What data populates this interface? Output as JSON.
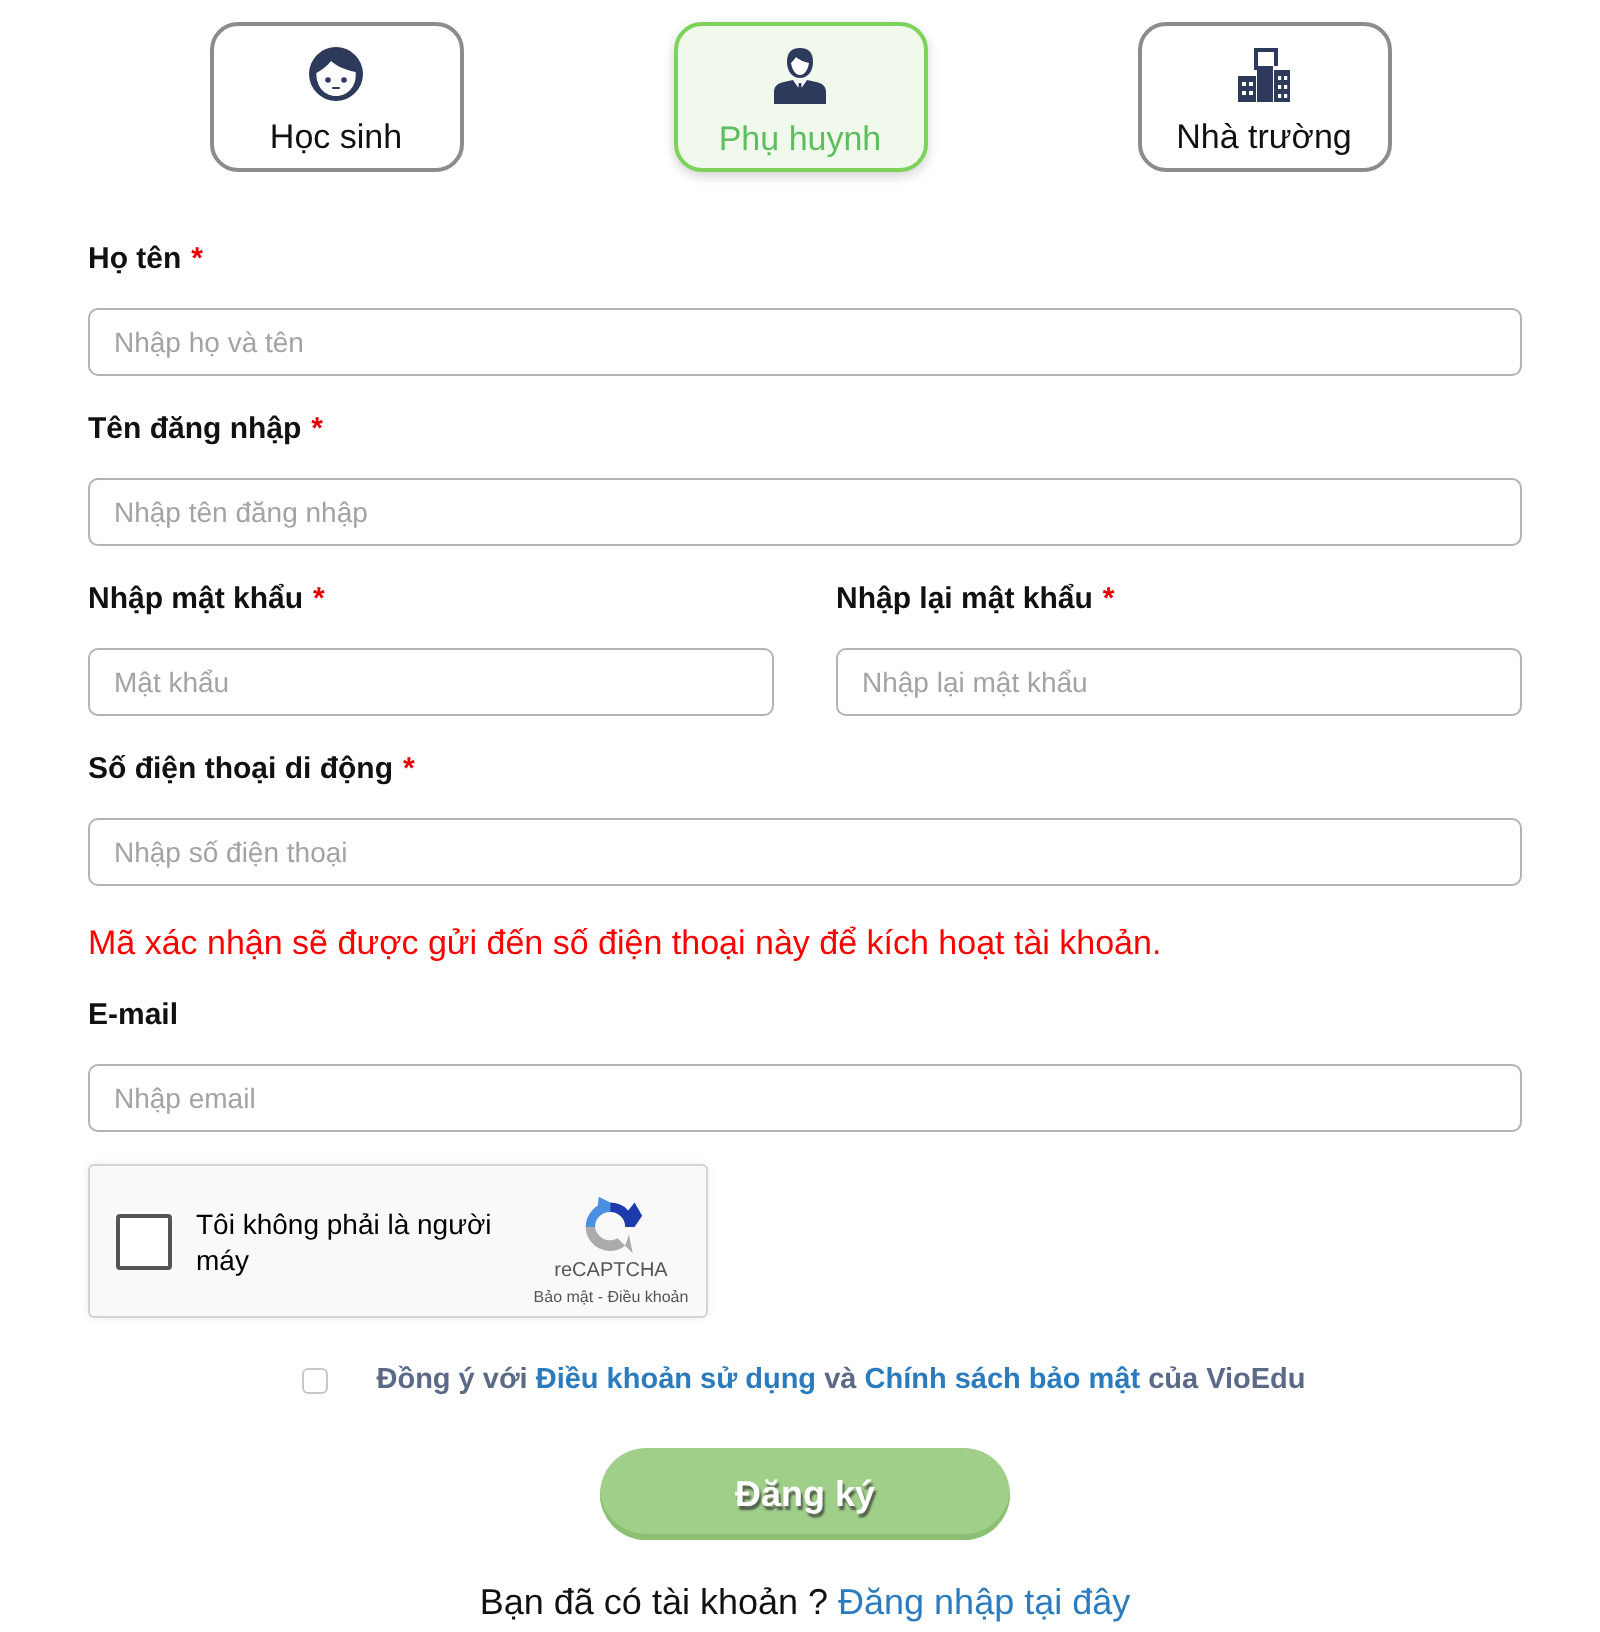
{
  "role_tabs": [
    {
      "kind": "student",
      "label": "Học sinh",
      "selected": false
    },
    {
      "kind": "parent",
      "label": "Phụ huynh",
      "selected": true
    },
    {
      "kind": "school",
      "label": "Nhà trường",
      "selected": false
    }
  ],
  "form_rows": [
    {
      "kind": "fields",
      "fields": [
        {
          "label": "Họ tên",
          "required_mark": "*",
          "placeholder": "Nhập họ và tên"
        }
      ]
    },
    {
      "kind": "fields",
      "fields": [
        {
          "label": "Tên đăng nhập",
          "required_mark": "*",
          "placeholder": "Nhập tên đăng nhập"
        }
      ]
    },
    {
      "kind": "fields",
      "fields": [
        {
          "label": "Nhập mật khẩu",
          "required_mark": "*",
          "placeholder": "Mật khẩu"
        },
        {
          "label": "Nhập lại mật khẩu",
          "required_mark": "*",
          "placeholder": "Nhập lại mật khẩu"
        }
      ]
    },
    {
      "kind": "fields",
      "fields": [
        {
          "label": "Số điện thoại di động",
          "required_mark": "*",
          "placeholder": "Nhập số điện thoại"
        }
      ]
    },
    {
      "kind": "notice",
      "text": "Mã xác nhận sẽ được gửi đến số điện thoại này để kích hoạt tài khoản."
    },
    {
      "kind": "fields",
      "fields": [
        {
          "label": "E-mail",
          "placeholder": "Nhập email"
        }
      ]
    }
  ],
  "captcha": {
    "checked": false,
    "label": "Tôi không phải là người máy",
    "brand": "reCAPTCHA",
    "links": [
      "Bảo mật",
      "Điều khoản"
    ],
    "separator": "-"
  },
  "agreement": {
    "checked": false,
    "parts": [
      {
        "kind": "text",
        "text": "Đồng ý với"
      },
      {
        "kind": "link",
        "text": "Điều khoản sử dụng"
      },
      {
        "kind": "text",
        "text": "và"
      },
      {
        "kind": "link",
        "text": "Chính sách bảo mật"
      },
      {
        "kind": "text",
        "text": "của VioEdu"
      }
    ]
  },
  "submit": {
    "label": "Đăng ký",
    "disabled": true
  },
  "login_prompt": {
    "text": "Bạn đã có tài khoản ?",
    "link": "Đăng nhập tại đây"
  }
}
